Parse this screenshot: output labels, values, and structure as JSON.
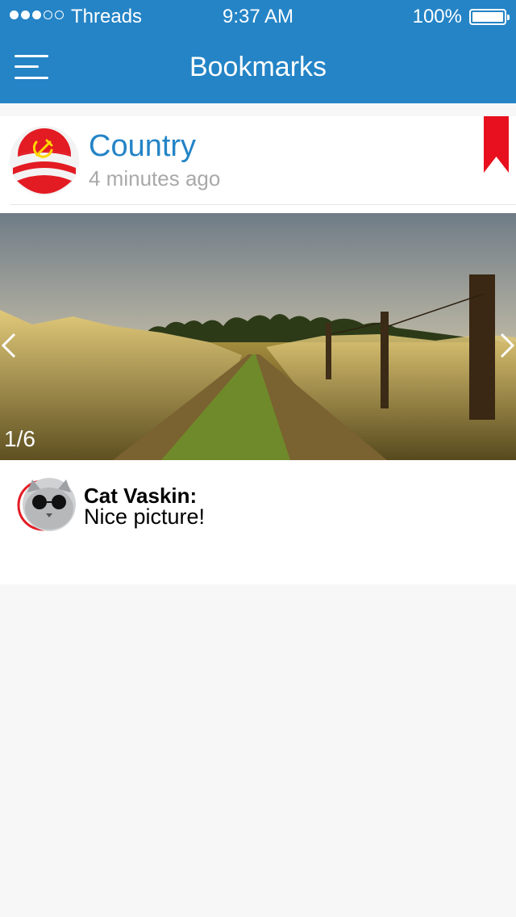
{
  "status_bar": {
    "carrier": "Threads",
    "time": "9:37 AM",
    "battery": "100%"
  },
  "nav": {
    "title": "Bookmarks",
    "menu_icon": "hamburger-menu-icon"
  },
  "post": {
    "title": "Country",
    "time": "4 minutes ago",
    "bookmarked": true,
    "photo_counter": "1/6"
  },
  "comment": {
    "author": "Cat Vaskin:",
    "text": "Nice picture!"
  },
  "colors": {
    "brand_blue": "#2484c6",
    "bookmark_red": "#e8101e",
    "secondary_text": "#a9a9a9",
    "background": "#f7f7f7"
  }
}
